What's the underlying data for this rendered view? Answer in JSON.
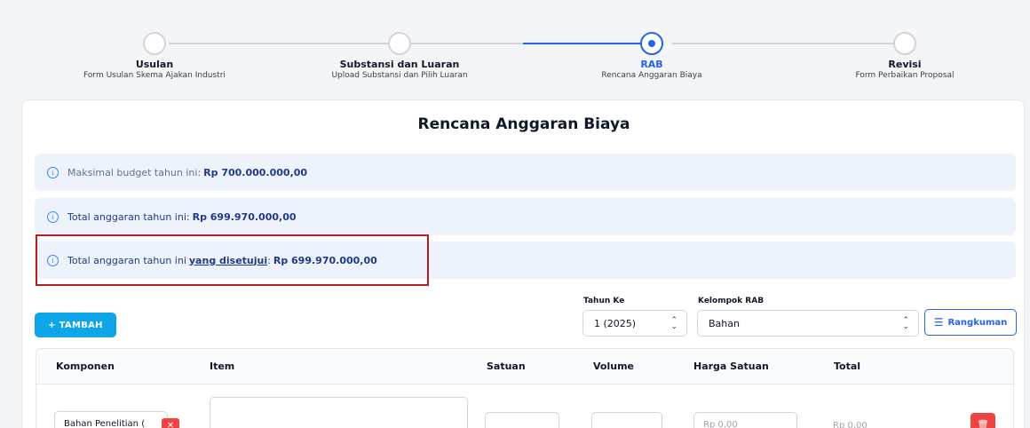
{
  "stepper": {
    "steps": [
      {
        "title": "Usulan",
        "subtitle": "Form Usulan Skema Ajakan Industri"
      },
      {
        "title": "Substansi dan Luaran",
        "subtitle": "Upload Substansi dan Pilih Luaran"
      },
      {
        "title": "RAB",
        "subtitle": "Rencana Anggaran Biaya"
      },
      {
        "title": "Revisi",
        "subtitle": "Form Perbaikan Proposal"
      }
    ],
    "active_index": 2
  },
  "card": {
    "title": "Rencana Anggaran Biaya",
    "alerts": {
      "max_budget_label": "Maksimal budget tahun ini:",
      "max_budget_value": "Rp 700.000.000,00",
      "total_label": "Total anggaran tahun ini:",
      "total_value": "Rp 699.970.000,00",
      "approved_label_pre": "Total anggaran tahun ini",
      "approved_label_link": "yang disetujui",
      "approved_label_post": ":",
      "approved_value": "Rp 699.970.000,00"
    }
  },
  "controls": {
    "tambah_label": "+ TAMBAH",
    "tahun_label": "Tahun Ke",
    "tahun_value": "1 (2025)",
    "kelompok_label": "Kelompok RAB",
    "kelompok_value": "Bahan",
    "rangkuman_label": "Rangkuman"
  },
  "table": {
    "headers": [
      "Komponen",
      "Item",
      "Satuan",
      "Volume",
      "Harga Satuan",
      "Total"
    ],
    "row": {
      "komponen": "Bahan Penelitian (",
      "harga_placeholder": "Rp 0,00",
      "total": "Rp 0,00"
    }
  },
  "colors": {
    "accent": "#2563eb",
    "primary_button": "#0ea5e9",
    "danger": "#ef4444",
    "highlight_border": "#b91c1c",
    "alert_bg": "#eef3fb"
  },
  "icons": {
    "info": "info-circle-icon",
    "rangkuman": "list-ordered-icon",
    "remove": "close-icon",
    "delete": "trash-icon"
  }
}
